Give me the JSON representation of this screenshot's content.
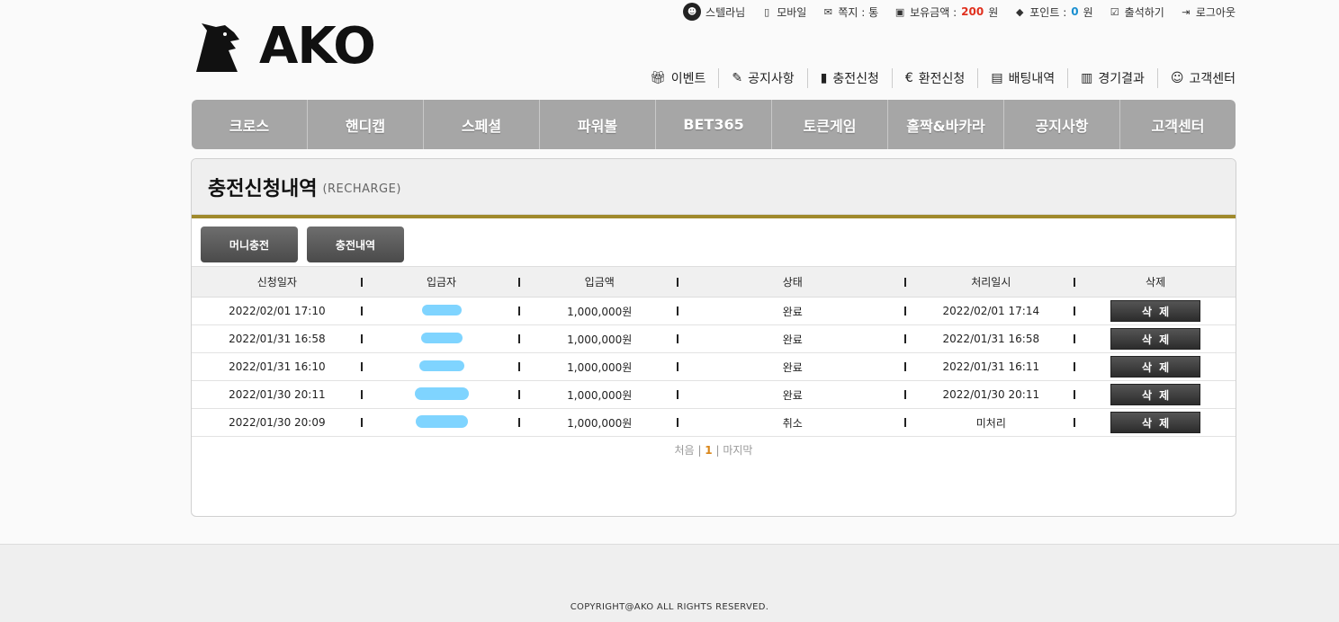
{
  "topbar": {
    "nickname": "스텔라님",
    "mobile": "모바일",
    "message": "쪽지 : 통",
    "balance_label": "보유금액 : ",
    "balance_value": "200",
    "balance_unit": "원",
    "points_label": "포인트 : ",
    "points_value": "0",
    "points_unit": "원",
    "attendance": "출석하기",
    "logout": "로그아웃"
  },
  "logo": {
    "text": "AKO"
  },
  "sublinks": {
    "event": "이벤트",
    "notice": "공지사항",
    "deposit": "충전신청",
    "withdraw": "환전신청",
    "bet_history": "배팅내역",
    "results": "경기결과",
    "support": "고객센터"
  },
  "mainnav": [
    "크로스",
    "핸디캡",
    "스페셜",
    "파워볼",
    "BET365",
    "토큰게임",
    "홀짝&바카라",
    "공지사항",
    "고객센터"
  ],
  "panel": {
    "title": "충전신청내역",
    "subtitle": "(RECHARGE)",
    "buttons": {
      "deposit": "머니충전",
      "history": "충전내역"
    }
  },
  "table": {
    "headers": [
      "신청일자",
      "입금자",
      "입금액",
      "상태",
      "처리일시",
      "삭제"
    ],
    "rows": [
      {
        "date": "2022/02/01 17:10",
        "amount": "1,000,000원",
        "status": "완료",
        "processed": "2022/02/01 17:14",
        "delete": "삭제"
      },
      {
        "date": "2022/01/31 16:58",
        "amount": "1,000,000원",
        "status": "완료",
        "processed": "2022/01/31 16:58",
        "delete": "삭제"
      },
      {
        "date": "2022/01/31 16:10",
        "amount": "1,000,000원",
        "status": "완료",
        "processed": "2022/01/31 16:11",
        "delete": "삭제"
      },
      {
        "date": "2022/01/30 20:11",
        "amount": "1,000,000원",
        "status": "완료",
        "processed": "2022/01/30 20:11",
        "delete": "삭제"
      },
      {
        "date": "2022/01/30 20:09",
        "amount": "1,000,000원",
        "status": "취소",
        "processed": "미처리",
        "delete": "삭제"
      }
    ]
  },
  "pager": {
    "first": "처음",
    "current": "1",
    "last": "마지막"
  },
  "footer": {
    "copyright": "COPYRIGHT@AKO ALL RIGHTS RESERVED."
  },
  "colors": {
    "gold": "#a08a2c",
    "balance": "#e0301e",
    "points": "#1a8fd0",
    "redaction": "#7fd4ff"
  }
}
